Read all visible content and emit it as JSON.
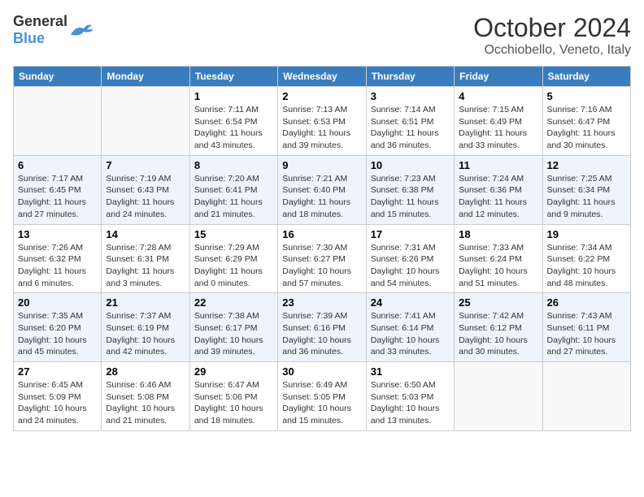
{
  "header": {
    "logo_general": "General",
    "logo_blue": "Blue",
    "month": "October 2024",
    "location": "Occhiobello, Veneto, Italy"
  },
  "days_of_week": [
    "Sunday",
    "Monday",
    "Tuesday",
    "Wednesday",
    "Thursday",
    "Friday",
    "Saturday"
  ],
  "weeks": [
    [
      {
        "day": "",
        "info": ""
      },
      {
        "day": "",
        "info": ""
      },
      {
        "day": "1",
        "info": "Sunrise: 7:11 AM\nSunset: 6:54 PM\nDaylight: 11 hours and 43 minutes."
      },
      {
        "day": "2",
        "info": "Sunrise: 7:13 AM\nSunset: 6:53 PM\nDaylight: 11 hours and 39 minutes."
      },
      {
        "day": "3",
        "info": "Sunrise: 7:14 AM\nSunset: 6:51 PM\nDaylight: 11 hours and 36 minutes."
      },
      {
        "day": "4",
        "info": "Sunrise: 7:15 AM\nSunset: 6:49 PM\nDaylight: 11 hours and 33 minutes."
      },
      {
        "day": "5",
        "info": "Sunrise: 7:16 AM\nSunset: 6:47 PM\nDaylight: 11 hours and 30 minutes."
      }
    ],
    [
      {
        "day": "6",
        "info": "Sunrise: 7:17 AM\nSunset: 6:45 PM\nDaylight: 11 hours and 27 minutes."
      },
      {
        "day": "7",
        "info": "Sunrise: 7:19 AM\nSunset: 6:43 PM\nDaylight: 11 hours and 24 minutes."
      },
      {
        "day": "8",
        "info": "Sunrise: 7:20 AM\nSunset: 6:41 PM\nDaylight: 11 hours and 21 minutes."
      },
      {
        "day": "9",
        "info": "Sunrise: 7:21 AM\nSunset: 6:40 PM\nDaylight: 11 hours and 18 minutes."
      },
      {
        "day": "10",
        "info": "Sunrise: 7:23 AM\nSunset: 6:38 PM\nDaylight: 11 hours and 15 minutes."
      },
      {
        "day": "11",
        "info": "Sunrise: 7:24 AM\nSunset: 6:36 PM\nDaylight: 11 hours and 12 minutes."
      },
      {
        "day": "12",
        "info": "Sunrise: 7:25 AM\nSunset: 6:34 PM\nDaylight: 11 hours and 9 minutes."
      }
    ],
    [
      {
        "day": "13",
        "info": "Sunrise: 7:26 AM\nSunset: 6:32 PM\nDaylight: 11 hours and 6 minutes."
      },
      {
        "day": "14",
        "info": "Sunrise: 7:28 AM\nSunset: 6:31 PM\nDaylight: 11 hours and 3 minutes."
      },
      {
        "day": "15",
        "info": "Sunrise: 7:29 AM\nSunset: 6:29 PM\nDaylight: 11 hours and 0 minutes."
      },
      {
        "day": "16",
        "info": "Sunrise: 7:30 AM\nSunset: 6:27 PM\nDaylight: 10 hours and 57 minutes."
      },
      {
        "day": "17",
        "info": "Sunrise: 7:31 AM\nSunset: 6:26 PM\nDaylight: 10 hours and 54 minutes."
      },
      {
        "day": "18",
        "info": "Sunrise: 7:33 AM\nSunset: 6:24 PM\nDaylight: 10 hours and 51 minutes."
      },
      {
        "day": "19",
        "info": "Sunrise: 7:34 AM\nSunset: 6:22 PM\nDaylight: 10 hours and 48 minutes."
      }
    ],
    [
      {
        "day": "20",
        "info": "Sunrise: 7:35 AM\nSunset: 6:20 PM\nDaylight: 10 hours and 45 minutes."
      },
      {
        "day": "21",
        "info": "Sunrise: 7:37 AM\nSunset: 6:19 PM\nDaylight: 10 hours and 42 minutes."
      },
      {
        "day": "22",
        "info": "Sunrise: 7:38 AM\nSunset: 6:17 PM\nDaylight: 10 hours and 39 minutes."
      },
      {
        "day": "23",
        "info": "Sunrise: 7:39 AM\nSunset: 6:16 PM\nDaylight: 10 hours and 36 minutes."
      },
      {
        "day": "24",
        "info": "Sunrise: 7:41 AM\nSunset: 6:14 PM\nDaylight: 10 hours and 33 minutes."
      },
      {
        "day": "25",
        "info": "Sunrise: 7:42 AM\nSunset: 6:12 PM\nDaylight: 10 hours and 30 minutes."
      },
      {
        "day": "26",
        "info": "Sunrise: 7:43 AM\nSunset: 6:11 PM\nDaylight: 10 hours and 27 minutes."
      }
    ],
    [
      {
        "day": "27",
        "info": "Sunrise: 6:45 AM\nSunset: 5:09 PM\nDaylight: 10 hours and 24 minutes."
      },
      {
        "day": "28",
        "info": "Sunrise: 6:46 AM\nSunset: 5:08 PM\nDaylight: 10 hours and 21 minutes."
      },
      {
        "day": "29",
        "info": "Sunrise: 6:47 AM\nSunset: 5:06 PM\nDaylight: 10 hours and 18 minutes."
      },
      {
        "day": "30",
        "info": "Sunrise: 6:49 AM\nSunset: 5:05 PM\nDaylight: 10 hours and 15 minutes."
      },
      {
        "day": "31",
        "info": "Sunrise: 6:50 AM\nSunset: 5:03 PM\nDaylight: 10 hours and 13 minutes."
      },
      {
        "day": "",
        "info": ""
      },
      {
        "day": "",
        "info": ""
      }
    ]
  ]
}
